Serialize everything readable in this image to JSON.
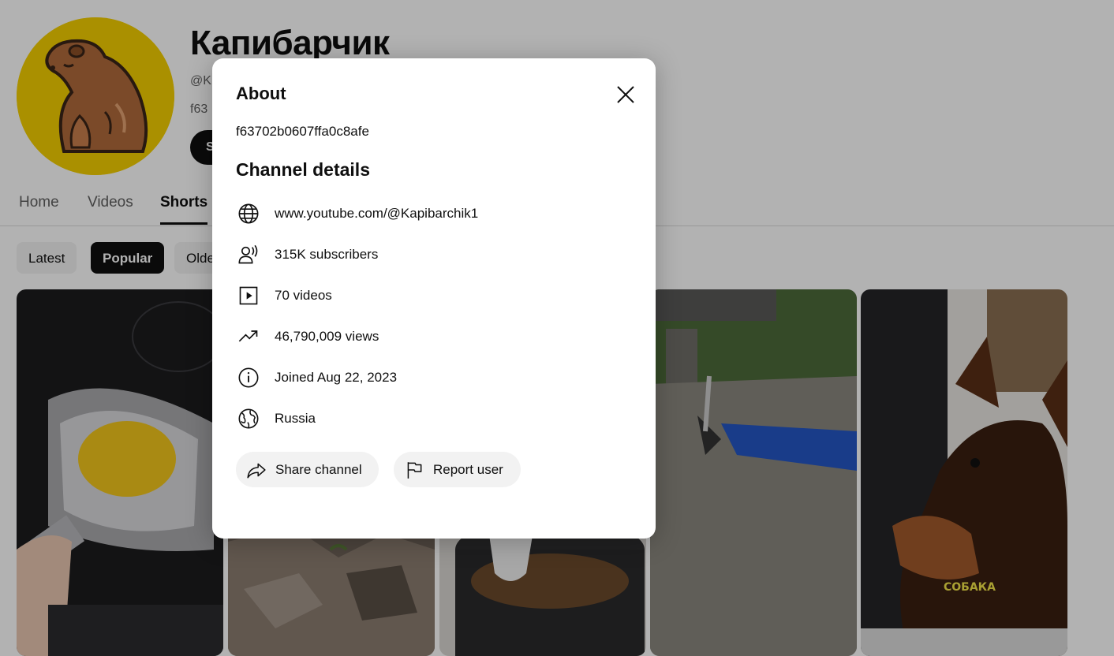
{
  "channel": {
    "name": "Капибарчик",
    "handle": "@K",
    "description": "f63",
    "subscribe_label": "S"
  },
  "tabs": [
    {
      "label": "Home"
    },
    {
      "label": "Videos"
    },
    {
      "label": "Shorts"
    }
  ],
  "chips": [
    {
      "label": "Latest"
    },
    {
      "label": "Popular"
    },
    {
      "label": "Olde"
    }
  ],
  "shorts": [
    {
      "caption": ""
    },
    {
      "caption": ""
    },
    {
      "caption": ""
    },
    {
      "caption": ""
    },
    {
      "caption": "СОБАКА"
    }
  ],
  "about": {
    "title": "About",
    "description": "f63702b0607ffa0c8afe",
    "details_title": "Channel details",
    "details": [
      {
        "icon": "globe-icon",
        "text": "www.youtube.com/@Kapibarchik1"
      },
      {
        "icon": "subscribers-icon",
        "text": "315K subscribers"
      },
      {
        "icon": "video-icon",
        "text": "70 videos"
      },
      {
        "icon": "trending-icon",
        "text": "46,790,009 views"
      },
      {
        "icon": "info-icon",
        "text": "Joined Aug 22, 2023"
      },
      {
        "icon": "globe-region-icon",
        "text": "Russia"
      }
    ],
    "share_label": "Share channel",
    "report_label": "Report user"
  },
  "colors": {
    "avatar_bg": "#f4cf00",
    "accent": "#0f0f0f",
    "chip_bg": "#f2f2f2"
  }
}
